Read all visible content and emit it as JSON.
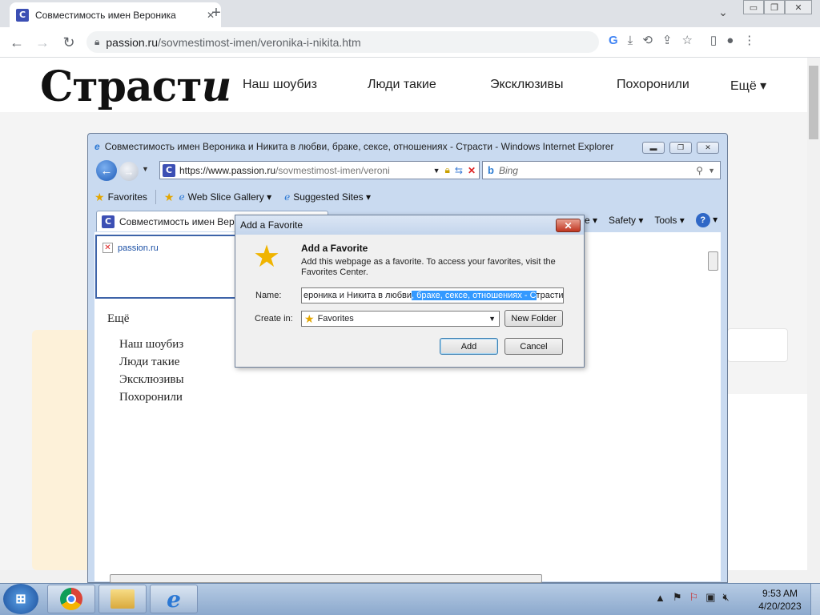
{
  "chrome": {
    "tab_title": "Совместимость имен Вероника",
    "tab_favicon": "С",
    "url_host": "passion.ru",
    "url_path": "/sovmestimost-imen/veronika-i-nikita.htm",
    "window_controls": [
      "⌄",
      "▭",
      "❐",
      "✕"
    ]
  },
  "site": {
    "logo_text": "Страст",
    "logo_italic": "и",
    "nav": [
      "Наш шоубиз",
      "Люди такие",
      "Эксклюзивы",
      "Похоронили",
      "Ещё ▾"
    ]
  },
  "ie": {
    "window_title": "Совместимость имен Вероника и Никита в любви, браке, сексе, отношениях - Страсти - Windows Internet Explorer",
    "address_scheme_host": "https://www.passion.ru",
    "address_path": "/sovmestimost-imen/veroni",
    "search_brand": "b",
    "search_placeholder": "Bing",
    "favorites_label": "Favorites",
    "web_slice_label": "Web Slice Gallery ▾",
    "suggested_sites_label": "Suggested Sites ▾",
    "tab_title": "Совместимость имен Веро",
    "page_label": "e ▾",
    "safety_label": "Safety ▾",
    "tools_label": "Tools ▾",
    "broken_link_text": "passion.ru",
    "menu_heading": "Ещё",
    "menu_items": [
      "Наш шоубиз",
      "Люди такие",
      "Эксклюзивы",
      "Похоронили"
    ]
  },
  "dialog": {
    "title": "Add a Favorite",
    "heading": "Add a Favorite",
    "description": "Add this webpage as a favorite. To access your favorites, visit the Favorites Center.",
    "name_label": "Name:",
    "name_value_pre": "ероника и Никита в любви",
    "name_value_selected": ", браке, сексе, отношениях - С",
    "name_value_post": "трасти",
    "create_in_label": "Create in:",
    "create_in_value": "Favorites",
    "new_folder_label": "New Folder",
    "add_label": "Add",
    "cancel_label": "Cancel"
  },
  "taskbar": {
    "time": "9:53 AM",
    "date": "4/20/2023"
  },
  "colors": {
    "selection": "#3399ff",
    "chrome_frame": "#dee1e6",
    "ie_frame": "#c9daf0"
  }
}
